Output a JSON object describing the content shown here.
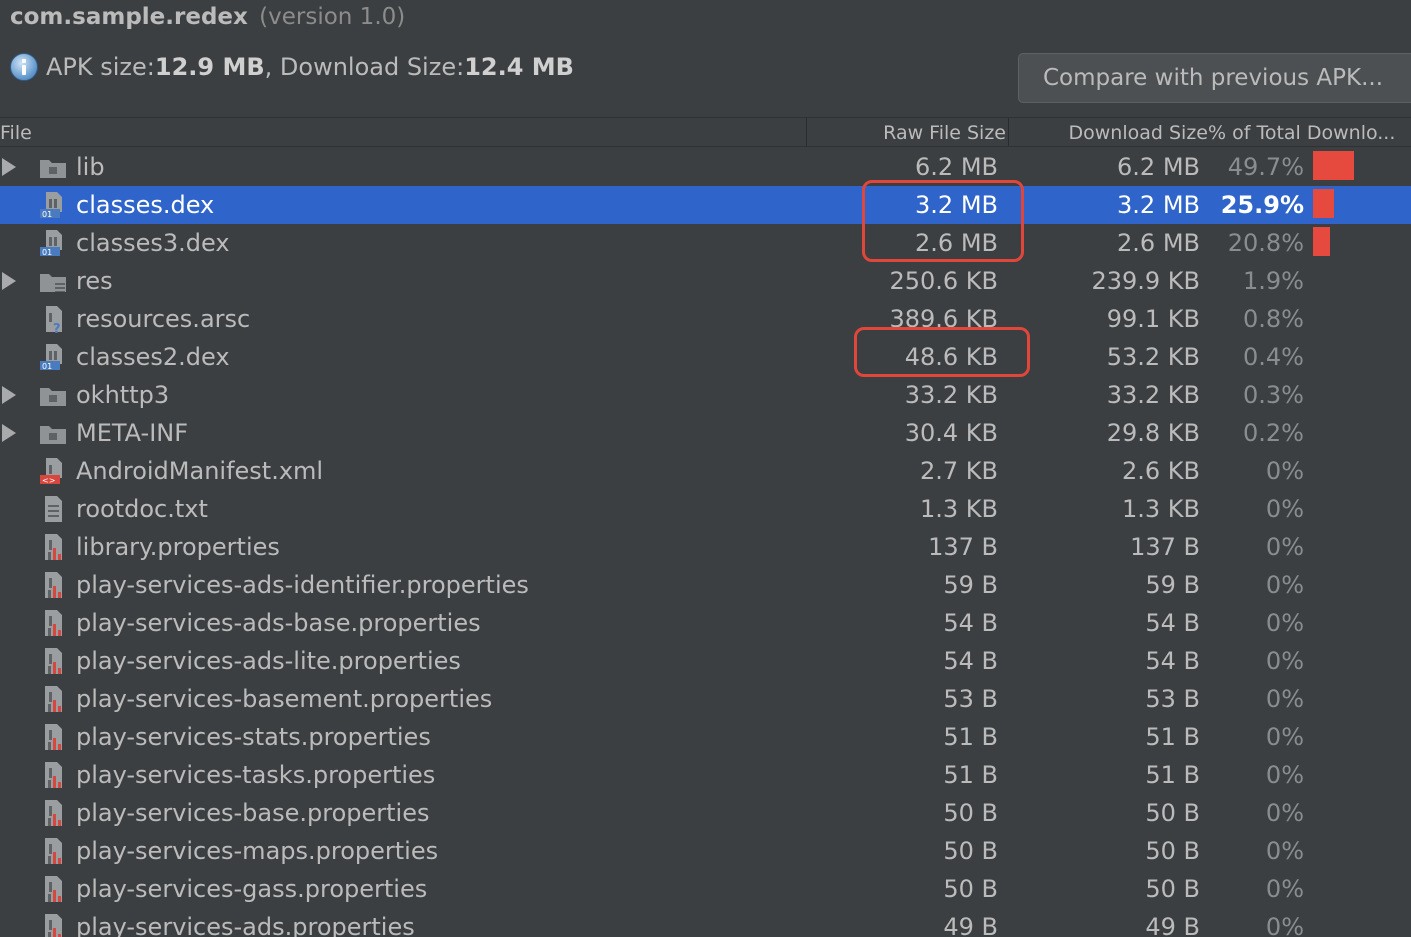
{
  "header": {
    "package": "com.sample.redex",
    "version": "(version 1.0)",
    "apk_label": "APK size: ",
    "apk_size": "12.9 MB",
    "dl_label": ", Download Size: ",
    "dl_size": "12.4 MB",
    "compare_button": "Compare with previous APK..."
  },
  "columns": {
    "file": "File",
    "raw": "Raw File Size",
    "download": "Download Size",
    "percent": "% of Total Downlo..."
  },
  "colors": {
    "selection": "#2f65ca",
    "bar": "#e64a3f",
    "highlight": "#e0463a"
  },
  "rows": [
    {
      "name": "lib",
      "raw": "6.2 MB",
      "dl": "6.2 MB",
      "pct": "49.7%",
      "share": 0.497,
      "icon": "folder-icon",
      "expandable": true
    },
    {
      "name": "classes.dex",
      "raw": "3.2 MB",
      "dl": "3.2 MB",
      "pct": "25.9%",
      "share": 0.259,
      "icon": "dex-file-icon",
      "selected": true
    },
    {
      "name": "classes3.dex",
      "raw": "2.6 MB",
      "dl": "2.6 MB",
      "pct": "20.8%",
      "share": 0.208,
      "icon": "dex-file-icon"
    },
    {
      "name": "res",
      "raw": "250.6 KB",
      "dl": "239.9 KB",
      "pct": "1.9%",
      "share": 0,
      "icon": "res-folder-icon",
      "expandable": true
    },
    {
      "name": "resources.arsc",
      "raw": "389.6 KB",
      "dl": "99.1 KB",
      "pct": "0.8%",
      "share": 0,
      "icon": "unknown-file-icon"
    },
    {
      "name": "classes2.dex",
      "raw": "48.6 KB",
      "dl": "53.2 KB",
      "pct": "0.4%",
      "share": 0,
      "icon": "dex-file-icon"
    },
    {
      "name": "okhttp3",
      "raw": "33.2 KB",
      "dl": "33.2 KB",
      "pct": "0.3%",
      "share": 0,
      "icon": "folder-icon",
      "expandable": true
    },
    {
      "name": "META-INF",
      "raw": "30.4 KB",
      "dl": "29.8 KB",
      "pct": "0.2%",
      "share": 0,
      "icon": "folder-icon",
      "expandable": true
    },
    {
      "name": "AndroidManifest.xml",
      "raw": "2.7 KB",
      "dl": "2.6 KB",
      "pct": "0%",
      "share": 0,
      "icon": "xml-file-icon"
    },
    {
      "name": "rootdoc.txt",
      "raw": "1.3 KB",
      "dl": "1.3 KB",
      "pct": "0%",
      "share": 0,
      "icon": "text-file-icon"
    },
    {
      "name": "library.properties",
      "raw": "137 B",
      "dl": "137 B",
      "pct": "0%",
      "share": 0,
      "icon": "properties-file-icon"
    },
    {
      "name": "play-services-ads-identifier.properties",
      "raw": "59 B",
      "dl": "59 B",
      "pct": "0%",
      "share": 0,
      "icon": "properties-file-icon"
    },
    {
      "name": "play-services-ads-base.properties",
      "raw": "54 B",
      "dl": "54 B",
      "pct": "0%",
      "share": 0,
      "icon": "properties-file-icon"
    },
    {
      "name": "play-services-ads-lite.properties",
      "raw": "54 B",
      "dl": "54 B",
      "pct": "0%",
      "share": 0,
      "icon": "properties-file-icon"
    },
    {
      "name": "play-services-basement.properties",
      "raw": "53 B",
      "dl": "53 B",
      "pct": "0%",
      "share": 0,
      "icon": "properties-file-icon"
    },
    {
      "name": "play-services-stats.properties",
      "raw": "51 B",
      "dl": "51 B",
      "pct": "0%",
      "share": 0,
      "icon": "properties-file-icon"
    },
    {
      "name": "play-services-tasks.properties",
      "raw": "51 B",
      "dl": "51 B",
      "pct": "0%",
      "share": 0,
      "icon": "properties-file-icon"
    },
    {
      "name": "play-services-base.properties",
      "raw": "50 B",
      "dl": "50 B",
      "pct": "0%",
      "share": 0,
      "icon": "properties-file-icon"
    },
    {
      "name": "play-services-maps.properties",
      "raw": "50 B",
      "dl": "50 B",
      "pct": "0%",
      "share": 0,
      "icon": "properties-file-icon"
    },
    {
      "name": "play-services-gass.properties",
      "raw": "50 B",
      "dl": "50 B",
      "pct": "0%",
      "share": 0,
      "icon": "properties-file-icon"
    },
    {
      "name": "play-services-ads.properties",
      "raw": "49 B",
      "dl": "49 B",
      "pct": "0%",
      "share": 0,
      "icon": "properties-file-icon"
    }
  ]
}
